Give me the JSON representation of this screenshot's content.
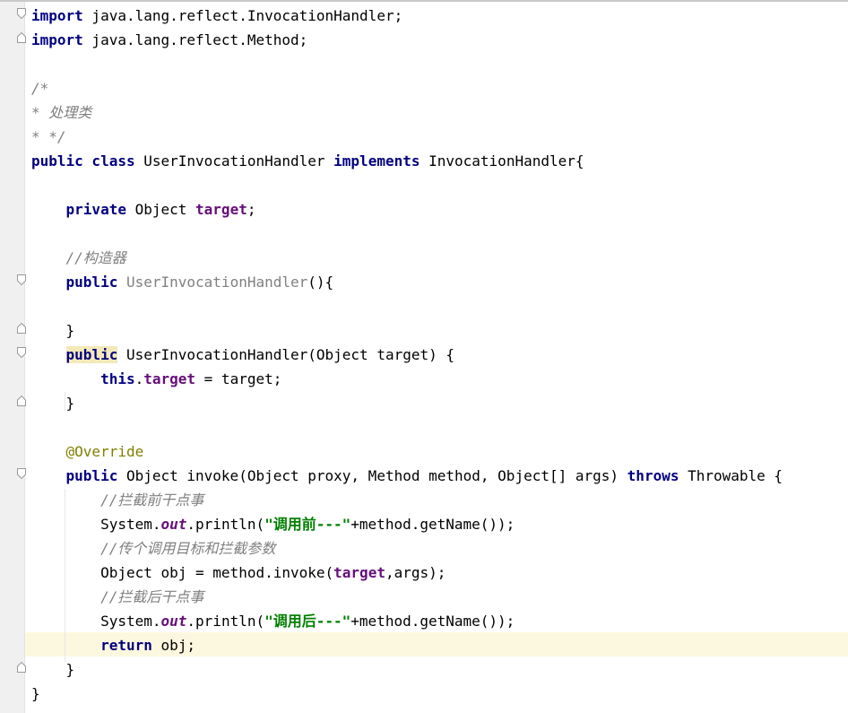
{
  "editor": {
    "lines": {
      "l1": [
        "import",
        " java.lang.reflect.InvocationHandler;"
      ],
      "l2": [
        "import",
        " java.lang.reflect.Method;"
      ],
      "l4": [
        "/*"
      ],
      "l5": [
        "* 处理类"
      ],
      "l6": [
        "* */"
      ],
      "l7": [
        "public class",
        " UserInvocationHandler ",
        "implements",
        " InvocationHandler{"
      ],
      "l9": [
        "    ",
        "private",
        " Object ",
        "target",
        ";"
      ],
      "l11": [
        "    ",
        "//构造器"
      ],
      "l12": [
        "    ",
        "public",
        " ",
        "UserInvocationHandler",
        "(){"
      ],
      "l14": [
        "    }"
      ],
      "l15": [
        "    ",
        "public",
        " UserInvocationHandler(Object target) {"
      ],
      "l16": [
        "        ",
        "this",
        ".",
        "target",
        " = target;"
      ],
      "l17": [
        "    }"
      ],
      "l19": [
        "    ",
        "@Override"
      ],
      "l20": [
        "    ",
        "public",
        " Object invoke(Object proxy, Method method, Object[] args) ",
        "throws",
        " Throwable {"
      ],
      "l21": [
        "        ",
        "//拦截前干点事"
      ],
      "l22": [
        "        System.",
        "out",
        ".println(",
        "\"调用前---\"",
        "+method.getName());"
      ],
      "l23": [
        "        ",
        "//传个调用目标和拦截参数"
      ],
      "l24": [
        "        Object obj = method.invoke(",
        "target",
        ",args);"
      ],
      "l25": [
        "        ",
        "//拦截后干点事"
      ],
      "l26": [
        "        System.",
        "out",
        ".println(",
        "\"调用后---\"",
        "+method.getName());"
      ],
      "l27": [
        "        ",
        "return",
        " obj;"
      ],
      "l28": [
        "    }"
      ],
      "l29": [
        "}"
      ]
    }
  },
  "colors": {
    "keyword": "#000080",
    "field": "#660e7a",
    "comment": "#808080",
    "string": "#008000",
    "annotation": "#808000",
    "gutter": "#f0f0f0",
    "caret_row": "#fcf8df"
  }
}
